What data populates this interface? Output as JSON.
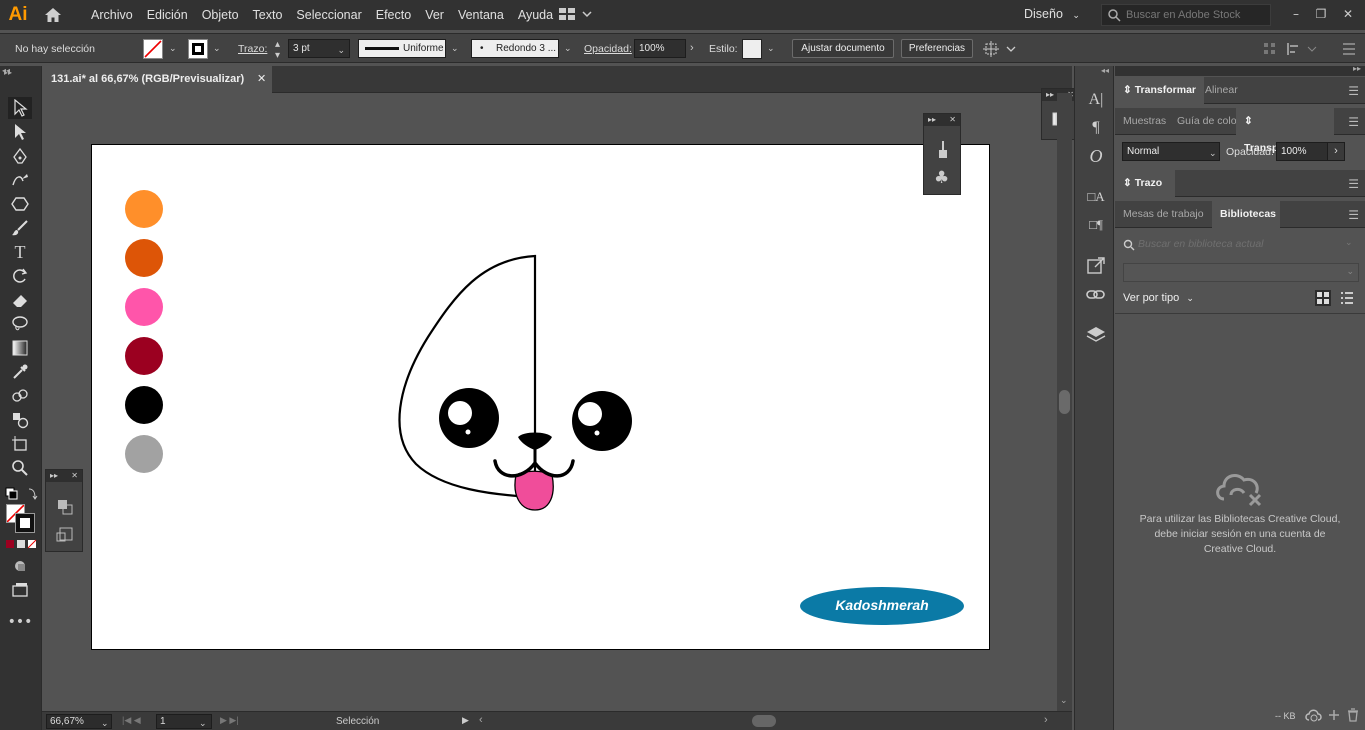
{
  "app": {
    "logo": "Ai"
  },
  "menu": [
    "Archivo",
    "Edición",
    "Objeto",
    "Texto",
    "Seleccionar",
    "Efecto",
    "Ver",
    "Ventana",
    "Ayuda"
  ],
  "workspace": {
    "label": "Diseño"
  },
  "stock_search": {
    "placeholder": "Buscar en Adobe Stock"
  },
  "control": {
    "selection": "No hay selección",
    "stroke_label": "Trazo:",
    "stroke_value": "3 pt",
    "profile": "Uniforme",
    "brush": "Redondo 3 ...",
    "opacity_label": "Opacidad:",
    "opacity_value": "100%",
    "style_label": "Estilo:",
    "adjust_button": "Ajustar documento",
    "prefs_button": "Preferencias"
  },
  "document_tab": {
    "title": "131.ai* al 66,67% (RGB/Previsualizar)"
  },
  "swatches": [
    "#ff8f2a",
    "#dd5507",
    "#ff55aa",
    "#9b0020",
    "#000000",
    "#a2a2a2"
  ],
  "artwork": {
    "tongue_color": "#f04d9a",
    "badge_color": "#0b7aa6",
    "badge_text": "Kadoshmerah"
  },
  "statusbar": {
    "zoom": "66,67%",
    "page": "1",
    "status": "Selección"
  },
  "panels": {
    "transform_tabs": [
      "Transformar",
      "Alinear"
    ],
    "transparency_tabs": [
      "Muestras",
      "Guía de colo",
      "Transparencia"
    ],
    "blend_mode": "Normal",
    "opacity_label": "Opacidad:",
    "opacity_value": "100%",
    "stroke_tab": "Trazo",
    "library_tabs": [
      "Mesas de trabajo",
      "Bibliotecas"
    ],
    "library_search_placeholder": "Buscar en biblioteca actual",
    "view_by": "Ver por tipo",
    "library_message": "Para utilizar las Bibliotecas Creative Cloud, debe iniciar sesión en una cuenta de Creative Cloud.",
    "kb_label": "-- KB"
  }
}
